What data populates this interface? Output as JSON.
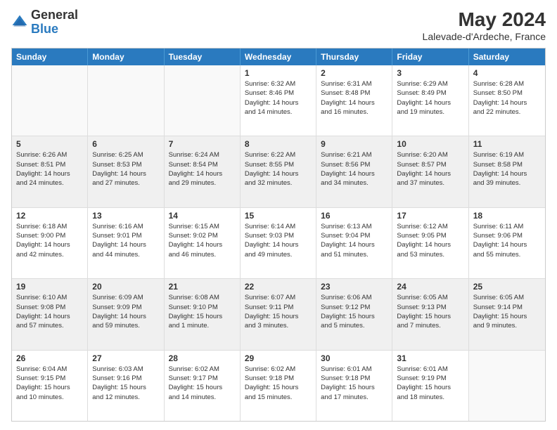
{
  "header": {
    "logo_general": "General",
    "logo_blue": "Blue",
    "main_title": "May 2024",
    "subtitle": "Lalevade-d'Ardeche, France"
  },
  "weekdays": [
    "Sunday",
    "Monday",
    "Tuesday",
    "Wednesday",
    "Thursday",
    "Friday",
    "Saturday"
  ],
  "rows": [
    [
      {
        "day": "",
        "lines": [],
        "empty": true
      },
      {
        "day": "",
        "lines": [],
        "empty": true
      },
      {
        "day": "",
        "lines": [],
        "empty": true
      },
      {
        "day": "1",
        "lines": [
          "Sunrise: 6:32 AM",
          "Sunset: 8:46 PM",
          "Daylight: 14 hours",
          "and 14 minutes."
        ]
      },
      {
        "day": "2",
        "lines": [
          "Sunrise: 6:31 AM",
          "Sunset: 8:48 PM",
          "Daylight: 14 hours",
          "and 16 minutes."
        ]
      },
      {
        "day": "3",
        "lines": [
          "Sunrise: 6:29 AM",
          "Sunset: 8:49 PM",
          "Daylight: 14 hours",
          "and 19 minutes."
        ]
      },
      {
        "day": "4",
        "lines": [
          "Sunrise: 6:28 AM",
          "Sunset: 8:50 PM",
          "Daylight: 14 hours",
          "and 22 minutes."
        ]
      }
    ],
    [
      {
        "day": "5",
        "lines": [
          "Sunrise: 6:26 AM",
          "Sunset: 8:51 PM",
          "Daylight: 14 hours",
          "and 24 minutes."
        ],
        "shaded": true
      },
      {
        "day": "6",
        "lines": [
          "Sunrise: 6:25 AM",
          "Sunset: 8:53 PM",
          "Daylight: 14 hours",
          "and 27 minutes."
        ],
        "shaded": true
      },
      {
        "day": "7",
        "lines": [
          "Sunrise: 6:24 AM",
          "Sunset: 8:54 PM",
          "Daylight: 14 hours",
          "and 29 minutes."
        ],
        "shaded": true
      },
      {
        "day": "8",
        "lines": [
          "Sunrise: 6:22 AM",
          "Sunset: 8:55 PM",
          "Daylight: 14 hours",
          "and 32 minutes."
        ],
        "shaded": true
      },
      {
        "day": "9",
        "lines": [
          "Sunrise: 6:21 AM",
          "Sunset: 8:56 PM",
          "Daylight: 14 hours",
          "and 34 minutes."
        ],
        "shaded": true
      },
      {
        "day": "10",
        "lines": [
          "Sunrise: 6:20 AM",
          "Sunset: 8:57 PM",
          "Daylight: 14 hours",
          "and 37 minutes."
        ],
        "shaded": true
      },
      {
        "day": "11",
        "lines": [
          "Sunrise: 6:19 AM",
          "Sunset: 8:58 PM",
          "Daylight: 14 hours",
          "and 39 minutes."
        ],
        "shaded": true
      }
    ],
    [
      {
        "day": "12",
        "lines": [
          "Sunrise: 6:18 AM",
          "Sunset: 9:00 PM",
          "Daylight: 14 hours",
          "and 42 minutes."
        ]
      },
      {
        "day": "13",
        "lines": [
          "Sunrise: 6:16 AM",
          "Sunset: 9:01 PM",
          "Daylight: 14 hours",
          "and 44 minutes."
        ]
      },
      {
        "day": "14",
        "lines": [
          "Sunrise: 6:15 AM",
          "Sunset: 9:02 PM",
          "Daylight: 14 hours",
          "and 46 minutes."
        ]
      },
      {
        "day": "15",
        "lines": [
          "Sunrise: 6:14 AM",
          "Sunset: 9:03 PM",
          "Daylight: 14 hours",
          "and 49 minutes."
        ]
      },
      {
        "day": "16",
        "lines": [
          "Sunrise: 6:13 AM",
          "Sunset: 9:04 PM",
          "Daylight: 14 hours",
          "and 51 minutes."
        ]
      },
      {
        "day": "17",
        "lines": [
          "Sunrise: 6:12 AM",
          "Sunset: 9:05 PM",
          "Daylight: 14 hours",
          "and 53 minutes."
        ]
      },
      {
        "day": "18",
        "lines": [
          "Sunrise: 6:11 AM",
          "Sunset: 9:06 PM",
          "Daylight: 14 hours",
          "and 55 minutes."
        ]
      }
    ],
    [
      {
        "day": "19",
        "lines": [
          "Sunrise: 6:10 AM",
          "Sunset: 9:08 PM",
          "Daylight: 14 hours",
          "and 57 minutes."
        ],
        "shaded": true
      },
      {
        "day": "20",
        "lines": [
          "Sunrise: 6:09 AM",
          "Sunset: 9:09 PM",
          "Daylight: 14 hours",
          "and 59 minutes."
        ],
        "shaded": true
      },
      {
        "day": "21",
        "lines": [
          "Sunrise: 6:08 AM",
          "Sunset: 9:10 PM",
          "Daylight: 15 hours",
          "and 1 minute."
        ],
        "shaded": true
      },
      {
        "day": "22",
        "lines": [
          "Sunrise: 6:07 AM",
          "Sunset: 9:11 PM",
          "Daylight: 15 hours",
          "and 3 minutes."
        ],
        "shaded": true
      },
      {
        "day": "23",
        "lines": [
          "Sunrise: 6:06 AM",
          "Sunset: 9:12 PM",
          "Daylight: 15 hours",
          "and 5 minutes."
        ],
        "shaded": true
      },
      {
        "day": "24",
        "lines": [
          "Sunrise: 6:05 AM",
          "Sunset: 9:13 PM",
          "Daylight: 15 hours",
          "and 7 minutes."
        ],
        "shaded": true
      },
      {
        "day": "25",
        "lines": [
          "Sunrise: 6:05 AM",
          "Sunset: 9:14 PM",
          "Daylight: 15 hours",
          "and 9 minutes."
        ],
        "shaded": true
      }
    ],
    [
      {
        "day": "26",
        "lines": [
          "Sunrise: 6:04 AM",
          "Sunset: 9:15 PM",
          "Daylight: 15 hours",
          "and 10 minutes."
        ]
      },
      {
        "day": "27",
        "lines": [
          "Sunrise: 6:03 AM",
          "Sunset: 9:16 PM",
          "Daylight: 15 hours",
          "and 12 minutes."
        ]
      },
      {
        "day": "28",
        "lines": [
          "Sunrise: 6:02 AM",
          "Sunset: 9:17 PM",
          "Daylight: 15 hours",
          "and 14 minutes."
        ]
      },
      {
        "day": "29",
        "lines": [
          "Sunrise: 6:02 AM",
          "Sunset: 9:18 PM",
          "Daylight: 15 hours",
          "and 15 minutes."
        ]
      },
      {
        "day": "30",
        "lines": [
          "Sunrise: 6:01 AM",
          "Sunset: 9:18 PM",
          "Daylight: 15 hours",
          "and 17 minutes."
        ]
      },
      {
        "day": "31",
        "lines": [
          "Sunrise: 6:01 AM",
          "Sunset: 9:19 PM",
          "Daylight: 15 hours",
          "and 18 minutes."
        ]
      },
      {
        "day": "",
        "lines": [],
        "empty": true
      }
    ]
  ]
}
